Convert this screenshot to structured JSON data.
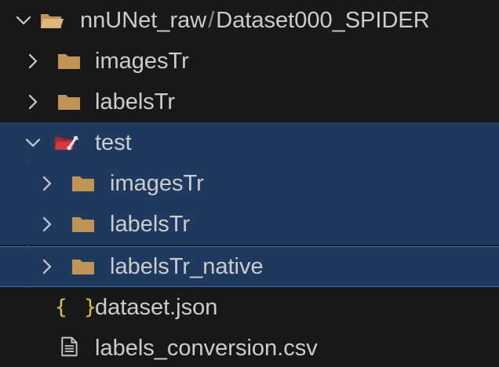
{
  "explorer": {
    "root": {
      "path_parent": "nnUNet_raw",
      "path_separator": "/",
      "path_name": "Dataset000_SPIDER"
    },
    "items": [
      {
        "label": "imagesTr"
      },
      {
        "label": "labelsTr"
      },
      {
        "label": "test"
      },
      {
        "label": "imagesTr"
      },
      {
        "label": "labelsTr"
      },
      {
        "label": "labelsTr_native"
      },
      {
        "label": "dataset.json",
        "icon_text": "{ }"
      },
      {
        "label": "labels_conversion.csv"
      }
    ]
  },
  "colors": {
    "background": "#181818",
    "selection": "#1e3a5f",
    "focus_border": "#2f6fbf",
    "folder": "#c09553",
    "json_icon": "#e2c035",
    "text": "#cccccc"
  }
}
